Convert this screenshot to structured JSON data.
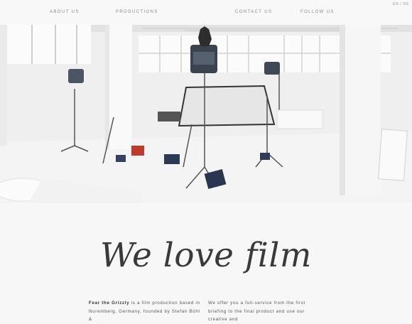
{
  "nav": {
    "items": [
      {
        "label": "ABOUT US"
      },
      {
        "label": "PRODUCTIONS"
      },
      {
        "label": "CONTACT US"
      },
      {
        "label": "FOLLOW US"
      }
    ],
    "lang": {
      "en": "EN",
      "sep": "/",
      "de": "DE"
    }
  },
  "logo": {
    "name": "grizzly-bear-logo"
  },
  "hero": {
    "description_icon": "film-studio-photo"
  },
  "headline": "We love film",
  "intro": {
    "left_bold": "Fear the Grizzly",
    "left_text": " is a film production based in Nuremberg, Germany, founded by Stefan Bühl &",
    "right_text": "We offer you a full-service from the first briefing to the final product and use our creative and"
  },
  "colors": {
    "background": "#f7f7f7",
    "nav_text": "#8a8a8a",
    "headline": "#3a3a3a",
    "accent_red": "#c0392b"
  }
}
